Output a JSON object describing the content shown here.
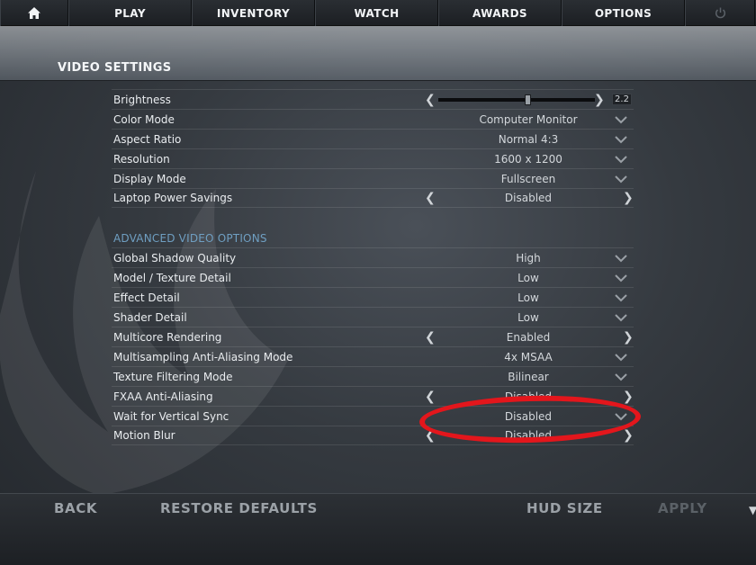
{
  "nav": {
    "home_icon": "home-icon",
    "tabs": [
      "PLAY",
      "INVENTORY",
      "WATCH",
      "AWARDS",
      "OPTIONS"
    ],
    "power_icon": "power-icon"
  },
  "page": {
    "title": "VIDEO SETTINGS"
  },
  "basic_settings": [
    {
      "label": "Brightness",
      "control": "slider",
      "value": "2.2",
      "level": 0.56
    },
    {
      "label": "Color Mode",
      "control": "dropdown",
      "value": "Computer Monitor"
    },
    {
      "label": "Aspect Ratio",
      "control": "dropdown",
      "value": "Normal 4:3"
    },
    {
      "label": "Resolution",
      "control": "dropdown",
      "value": "1600 x 1200"
    },
    {
      "label": "Display Mode",
      "control": "dropdown",
      "value": "Fullscreen"
    },
    {
      "label": "Laptop Power Savings",
      "control": "arrows",
      "value": "Disabled"
    }
  ],
  "advanced": {
    "heading": "ADVANCED VIDEO OPTIONS",
    "settings": [
      {
        "label": "Global Shadow Quality",
        "control": "dropdown",
        "value": "High"
      },
      {
        "label": "Model / Texture Detail",
        "control": "dropdown",
        "value": "Low"
      },
      {
        "label": "Effect Detail",
        "control": "dropdown",
        "value": "Low"
      },
      {
        "label": "Shader Detail",
        "control": "dropdown",
        "value": "Low"
      },
      {
        "label": "Multicore Rendering",
        "control": "arrows",
        "value": "Enabled"
      },
      {
        "label": "Multisampling Anti-Aliasing Mode",
        "control": "dropdown",
        "value": "4x MSAA"
      },
      {
        "label": "Texture Filtering Mode",
        "control": "dropdown",
        "value": "Bilinear"
      },
      {
        "label": "FXAA Anti-Aliasing",
        "control": "arrows",
        "value": "Disabled"
      },
      {
        "label": "Wait for Vertical Sync",
        "control": "dropdown",
        "value": "Disabled"
      },
      {
        "label": "Motion Blur",
        "control": "arrows",
        "value": "Disabled"
      }
    ]
  },
  "bottom": {
    "back": "BACK",
    "restore": "RESTORE DEFAULTS",
    "hud_size": "HUD SIZE",
    "apply": "APPLY"
  },
  "colors": {
    "accent_heading": "#6f9fc2",
    "highlight": "#e3161c"
  }
}
